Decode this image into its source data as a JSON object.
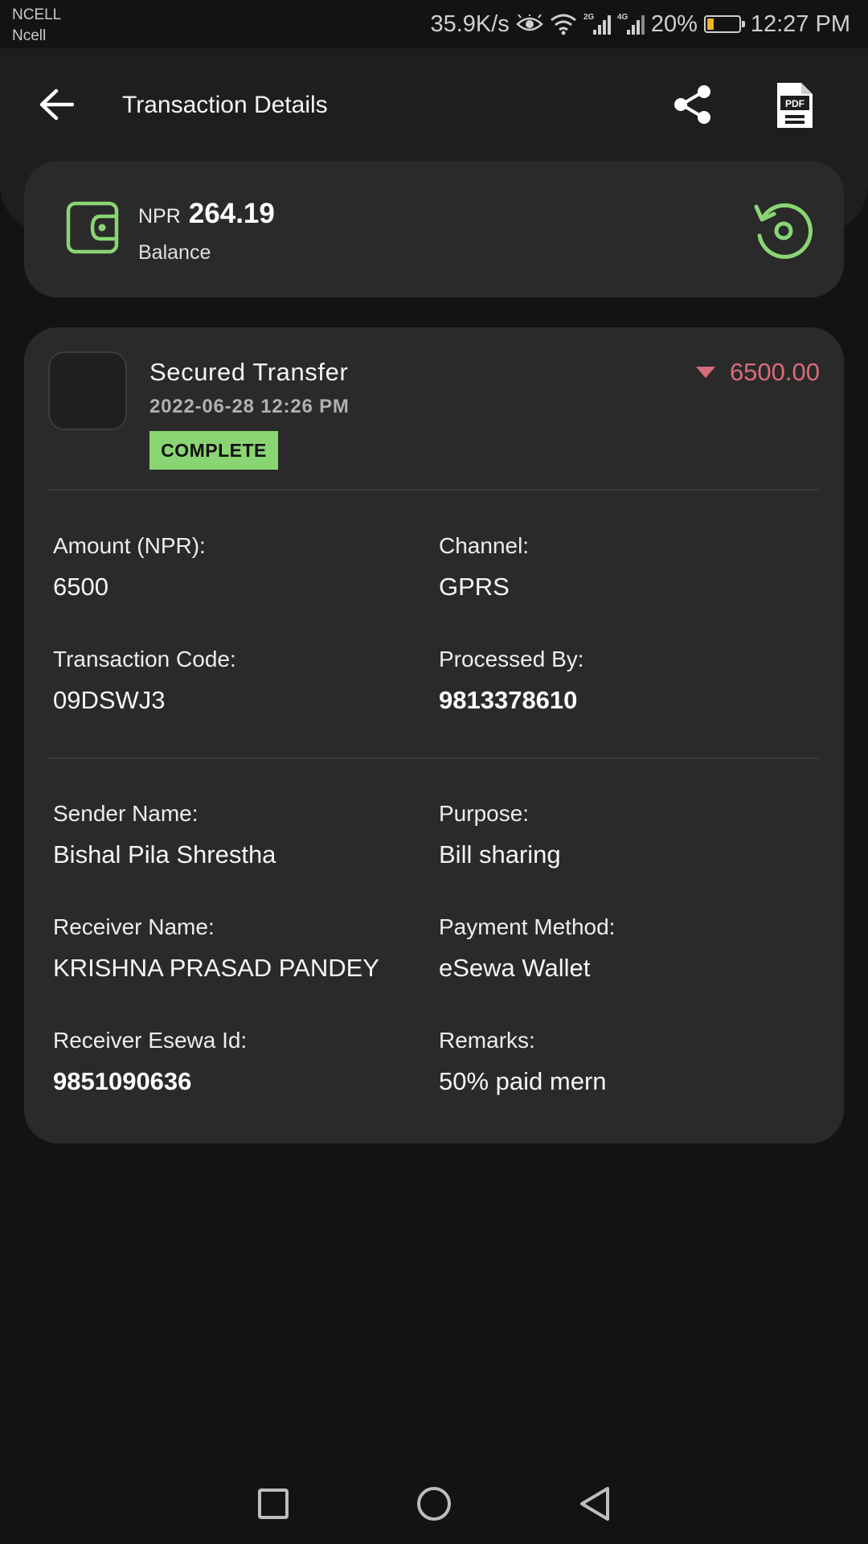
{
  "status_bar": {
    "carrier_primary": "NCELL",
    "carrier_secondary": "Ncell",
    "network_speed": "35.9K/s",
    "network_2g": "2G",
    "network_4g": "4G",
    "battery": "20%",
    "battery_level": 0.2,
    "time": "12:27 PM"
  },
  "header": {
    "title": "Transaction Details",
    "back_icon": "arrow-left-icon",
    "share_icon": "share-icon",
    "pdf_icon": "pdf-file-icon",
    "pdf_icon_text": "PDF"
  },
  "balance": {
    "currency": "NPR",
    "amount": "264.19",
    "label": "Balance",
    "wallet_icon": "wallet-icon",
    "refresh_icon": "refresh-icon"
  },
  "transaction": {
    "title": "Secured Transfer",
    "datetime": "2022-06-28 12:26 PM",
    "status": "COMPLETE",
    "amount": "6500.00",
    "direction_icon": "caret-down-icon",
    "fields": {
      "amount": {
        "label": "Amount (NPR):",
        "value": "6500"
      },
      "channel": {
        "label": "Channel:",
        "value": "GPRS"
      },
      "transaction_code": {
        "label": "Transaction Code:",
        "value": "09DSWJ3"
      },
      "processed_by": {
        "label": "Processed By:",
        "value": "9813378610"
      },
      "sender_name": {
        "label": "Sender Name:",
        "value": "Bishal Pila Shrestha"
      },
      "purpose": {
        "label": "Purpose:",
        "value": "Bill sharing"
      },
      "receiver_name": {
        "label": "Receiver Name:",
        "value": "KRISHNA PRASAD PANDEY"
      },
      "payment_method": {
        "label": "Payment Method:",
        "value": "eSewa Wallet"
      },
      "receiver_esewa_id": {
        "label": "Receiver Esewa Id:",
        "value": "9851090636"
      },
      "remarks": {
        "label": "Remarks:",
        "value": "50% paid mern"
      }
    }
  },
  "nav": {
    "recents_icon": "square-icon",
    "home_icon": "circle-icon",
    "back_icon": "triangle-back-icon"
  },
  "colors": {
    "background": "#131313",
    "card": "#2a2a2a",
    "accent_green": "#8ad573",
    "debit_red": "#d96b7b"
  }
}
